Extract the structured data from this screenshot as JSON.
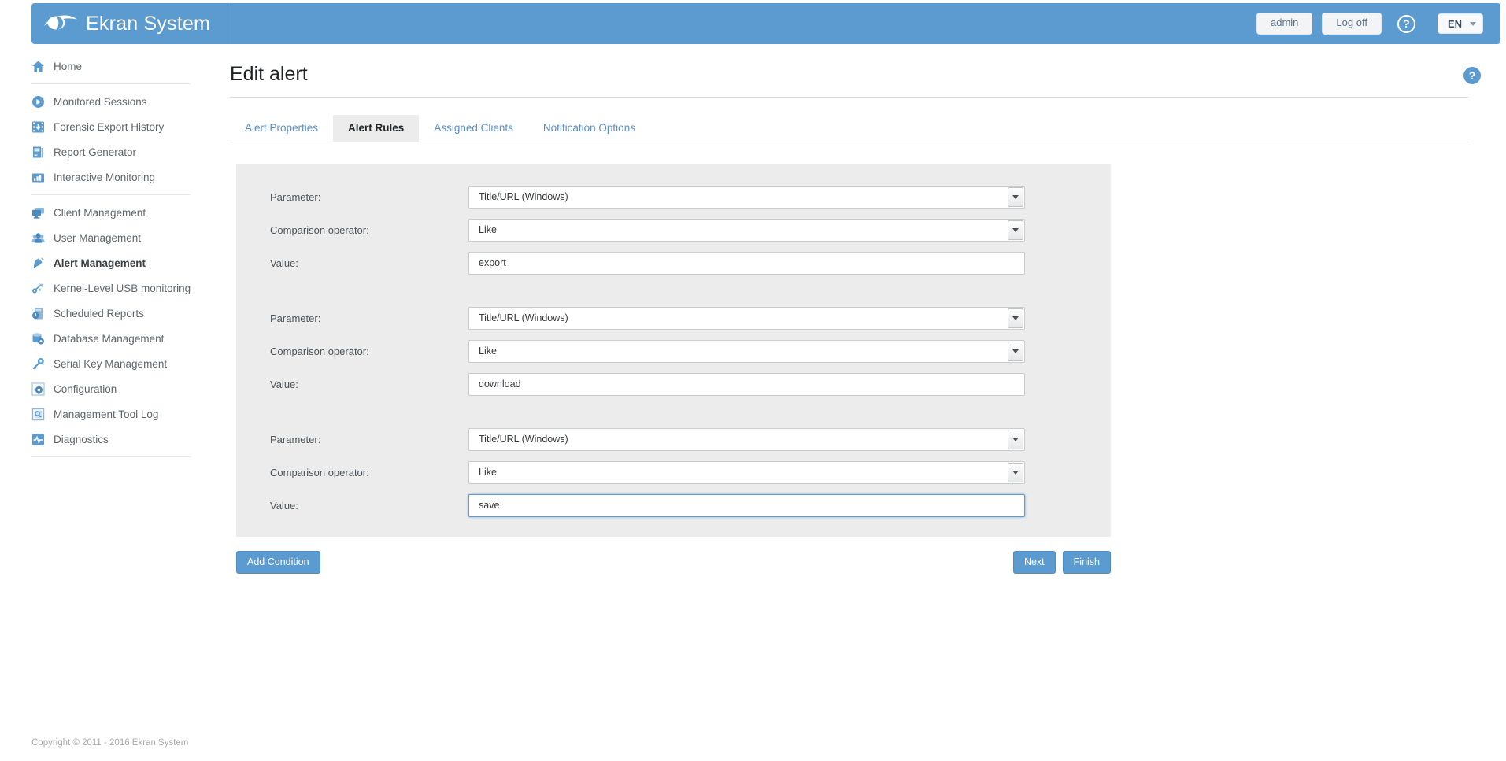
{
  "header": {
    "brand_name": "Ekran System",
    "logo_icon": "eye-icon",
    "user_button": "admin",
    "logoff_button": "Log off",
    "help_icon": "?",
    "language": "EN",
    "brand_color": "#5b9bd0"
  },
  "sidebar": {
    "groups": [
      {
        "items": [
          {
            "label": "Home",
            "icon": "home-icon",
            "active": false
          }
        ]
      },
      {
        "items": [
          {
            "label": "Monitored Sessions",
            "icon": "play-monitor-icon",
            "active": false
          },
          {
            "label": "Forensic Export History",
            "icon": "film-download-icon",
            "active": false
          },
          {
            "label": "Report Generator",
            "icon": "report-icon",
            "active": false
          },
          {
            "label": "Interactive Monitoring",
            "icon": "bar-chart-icon",
            "active": false
          }
        ]
      },
      {
        "items": [
          {
            "label": "Client Management",
            "icon": "monitor-icon",
            "active": false
          },
          {
            "label": "User Management",
            "icon": "users-icon",
            "active": false
          },
          {
            "label": "Alert Management",
            "icon": "alert-bell-icon",
            "active": true
          },
          {
            "label": "Kernel-Level USB monitoring",
            "icon": "usb-icon",
            "active": false
          },
          {
            "label": "Scheduled Reports",
            "icon": "clock-report-icon",
            "active": false
          },
          {
            "label": "Database Management",
            "icon": "database-gear-icon",
            "active": false
          },
          {
            "label": "Serial Key Management",
            "icon": "key-icon",
            "active": false
          },
          {
            "label": "Configuration",
            "icon": "gear-icon",
            "active": false
          },
          {
            "label": "Management Tool Log",
            "icon": "log-icon",
            "active": false
          },
          {
            "label": "Diagnostics",
            "icon": "diagnostics-icon",
            "active": false
          }
        ]
      }
    ]
  },
  "main": {
    "page_title": "Edit alert",
    "help_icon": "?",
    "tabs": [
      {
        "label": "Alert Properties",
        "active": false
      },
      {
        "label": "Alert Rules",
        "active": true
      },
      {
        "label": "Assigned Clients",
        "active": false
      },
      {
        "label": "Notification Options",
        "active": false
      }
    ],
    "field_labels": {
      "parameter": "Parameter:",
      "comparison_operator": "Comparison operator:",
      "value": "Value:"
    },
    "conditions": [
      {
        "parameter": "Title/URL (Windows)",
        "operator": "Like",
        "value": "export",
        "focused": false
      },
      {
        "parameter": "Title/URL (Windows)",
        "operator": "Like",
        "value": "download",
        "focused": false
      },
      {
        "parameter": "Title/URL (Windows)",
        "operator": "Like",
        "value": "save",
        "focused": true
      }
    ],
    "buttons": {
      "add_condition": "Add Condition",
      "next": "Next",
      "finish": "Finish"
    }
  },
  "footer": {
    "copyright": "Copyright © 2011 - 2016 Ekran System"
  }
}
